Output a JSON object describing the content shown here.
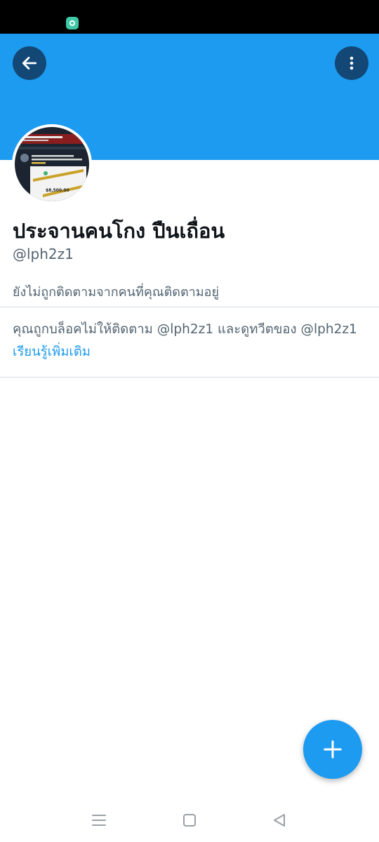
{
  "profile": {
    "display_name": "ประจานคนโกง ปืนเถื่อน",
    "handle": "@lph2z1",
    "follow_note": "ยังไม่ถูกติดตามจากคนที่คุณติดตามอยู่",
    "avatar_text": "$8,500.00"
  },
  "blocked": {
    "message_part1": "คุณถูกบล็อคไม่ให้ติดตาม @lph2z1 และดูทวีตของ @lph2z1",
    "learn_more": "เรียนรู้เพิ่มเติม"
  },
  "colors": {
    "banner": "#1d9bf0",
    "accent": "#1d9bf0",
    "secondary_text": "#536471"
  },
  "icons": {
    "back": "arrow-left-icon",
    "more": "more-vertical-icon",
    "compose": "plus-icon",
    "nav_menu": "recent-apps-icon",
    "nav_home": "home-square-icon",
    "nav_back": "back-triangle-icon"
  }
}
